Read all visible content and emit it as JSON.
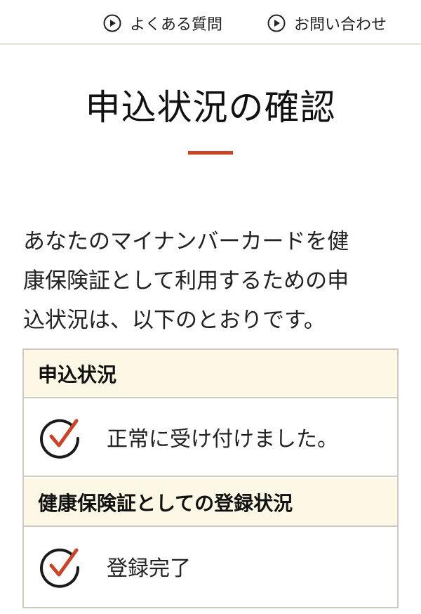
{
  "header": {
    "links": [
      {
        "label": "よくある質問",
        "icon": "play-circle-icon"
      },
      {
        "label": "お問い合わせ",
        "icon": "play-circle-icon"
      }
    ]
  },
  "main": {
    "title": "申込状況の確認",
    "intro_lines": [
      "あなたのマイナンバーカードを健",
      "康保険証として利用するための申",
      "込状況は、以下のとおりです。"
    ],
    "status_table": {
      "sections": [
        {
          "heading": "申込状況",
          "status_icon": "check-circle-icon",
          "status": "正常に受け付けました。"
        },
        {
          "heading": "健康保険証としての登録状況",
          "status_icon": "check-circle-icon",
          "status": "登録完了"
        }
      ]
    }
  },
  "colors": {
    "accent": "#c8452b",
    "header_row_bg": "#fdf8e6",
    "border": "#cfc9c3"
  }
}
